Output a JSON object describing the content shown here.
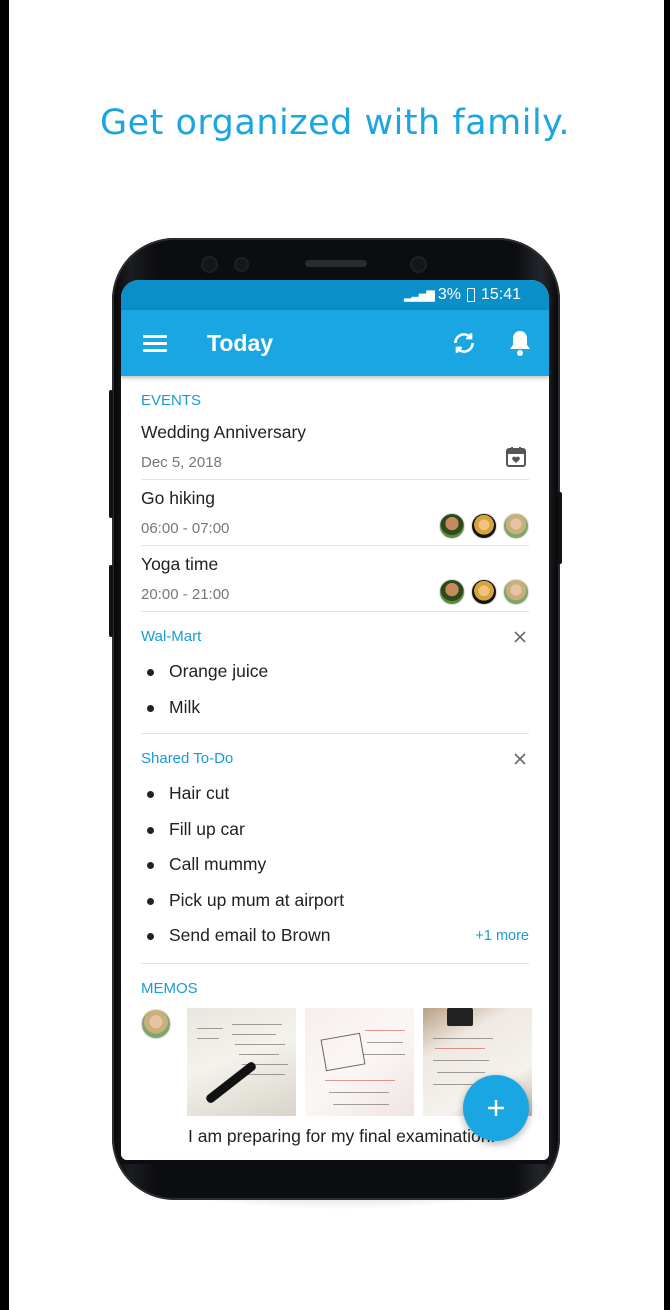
{
  "headline": "Get organized with family.",
  "statusbar": {
    "signal": "📶",
    "battery": "3%",
    "time": "15:41"
  },
  "appbar": {
    "title": "Today"
  },
  "events": {
    "header": "EVENTS",
    "items": [
      {
        "title": "Wedding Anniversary",
        "sub": "Dec 5, 2018",
        "icon": "calendar-heart-icon"
      },
      {
        "title": "Go hiking",
        "sub": "06:00 - 07:00"
      },
      {
        "title": "Yoga time",
        "sub": "20:00 - 21:00"
      }
    ]
  },
  "lists": [
    {
      "name": "Wal-Mart",
      "items": [
        "Orange juice",
        "Milk"
      ]
    },
    {
      "name": "Shared To-Do",
      "items": [
        "Hair cut",
        "Fill up car",
        "Call mummy",
        "Pick up mum at airport",
        "Send email to Brown"
      ],
      "more": "+1 more"
    }
  ],
  "memos": {
    "header": "MEMOS",
    "text": "I am preparing for my final examination."
  },
  "colors": {
    "accent": "#1aa6e3",
    "statusbar": "#0b8fc9",
    "headline": "#1aa6e0"
  }
}
